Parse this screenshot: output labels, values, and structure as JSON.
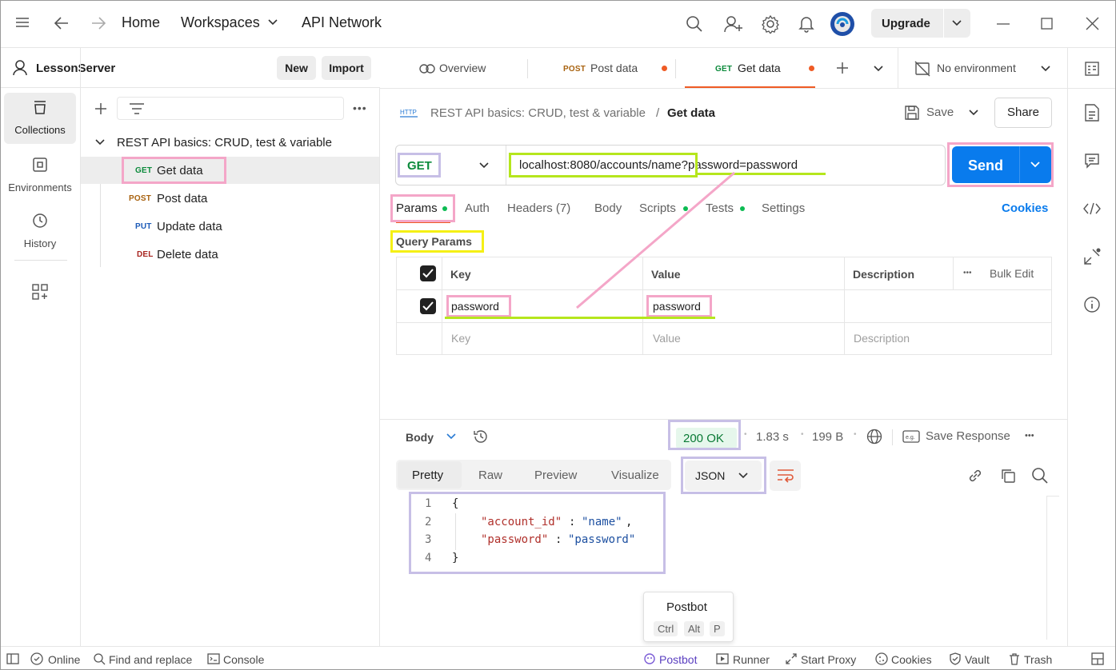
{
  "topbar": {
    "home": "Home",
    "workspaces": "Workspaces",
    "api_network": "API Network",
    "upgrade": "Upgrade"
  },
  "sidebar": {
    "workspace_name": "LessonServer",
    "new_label": "New",
    "import_label": "Import",
    "rail": [
      {
        "label": "Collections",
        "icon": "collections-icon"
      },
      {
        "label": "Environments",
        "icon": "environments-icon"
      },
      {
        "label": "History",
        "icon": "history-icon"
      }
    ],
    "collection_name": "REST API basics: CRUD, test & variable",
    "requests": [
      {
        "method": "GET",
        "name": "Get data",
        "color": "#0b8a3b"
      },
      {
        "method": "POST",
        "name": "Post data",
        "color": "#a8620f"
      },
      {
        "method": "PUT",
        "name": "Update data",
        "color": "#1d5bb8"
      },
      {
        "method": "DEL",
        "name": "Delete data",
        "color": "#a8241f"
      }
    ]
  },
  "tabs": {
    "overview": "Overview",
    "tab1_method": "POST",
    "tab1_name": "Post data",
    "tab2_method": "GET",
    "tab2_name": "Get data",
    "environment": "No environment"
  },
  "request": {
    "breadcrumb_collection": "REST API basics: CRUD, test & variable",
    "breadcrumb_sep": "/",
    "breadcrumb_request": "Get data",
    "save_label": "Save",
    "share_label": "Share",
    "method": "GET",
    "url": "localhost:8080/accounts/name?password=password",
    "send_label": "Send",
    "subtabs": {
      "params": "Params",
      "auth": "Auth",
      "headers": "Headers (7)",
      "body": "Body",
      "scripts": "Scripts",
      "tests": "Tests",
      "settings": "Settings",
      "cookies": "Cookies"
    },
    "query_params_title": "Query Params",
    "table": {
      "headers": {
        "key": "Key",
        "value": "Value",
        "description": "Description",
        "bulk_edit": "Bulk Edit"
      },
      "rows": [
        {
          "key": "password",
          "value": "password"
        }
      ],
      "placeholders": {
        "key": "Key",
        "value": "Value",
        "description": "Description"
      }
    }
  },
  "response": {
    "body_label": "Body",
    "status": "200 OK",
    "time": "1.83 s",
    "size": "199 B",
    "save_response": "Save Response",
    "views": {
      "pretty": "Pretty",
      "raw": "Raw",
      "preview": "Preview",
      "visualize": "Visualize"
    },
    "format": "JSON",
    "code": {
      "line_numbers": [
        "1",
        "2",
        "3",
        "4"
      ],
      "open_brace": "{",
      "close_brace": "}",
      "k1": "\"account_id\"",
      "v1": "\"name\"",
      "k2": "\"password\"",
      "v2": "\"password\"",
      "colon": ":",
      "comma": ","
    }
  },
  "postbot_popup": {
    "title": "Postbot",
    "keys": [
      "Ctrl",
      "Alt",
      "P"
    ]
  },
  "statusbar": {
    "online": "Online",
    "find_replace": "Find and replace",
    "console": "Console",
    "postbot": "Postbot",
    "runner": "Runner",
    "start_proxy": "Start Proxy",
    "cookies": "Cookies",
    "vault": "Vault",
    "trash": "Trash"
  },
  "colors": {
    "accent_blue": "#097bed",
    "ok_green_bg": "#e6f7ec",
    "ok_green_text": "#0a7a35",
    "annotation_pink": "#f4a6c8",
    "annotation_lavender": "#c7bfe6",
    "annotation_lime": "#b5e61d",
    "annotation_yellow": "#f5f015"
  }
}
